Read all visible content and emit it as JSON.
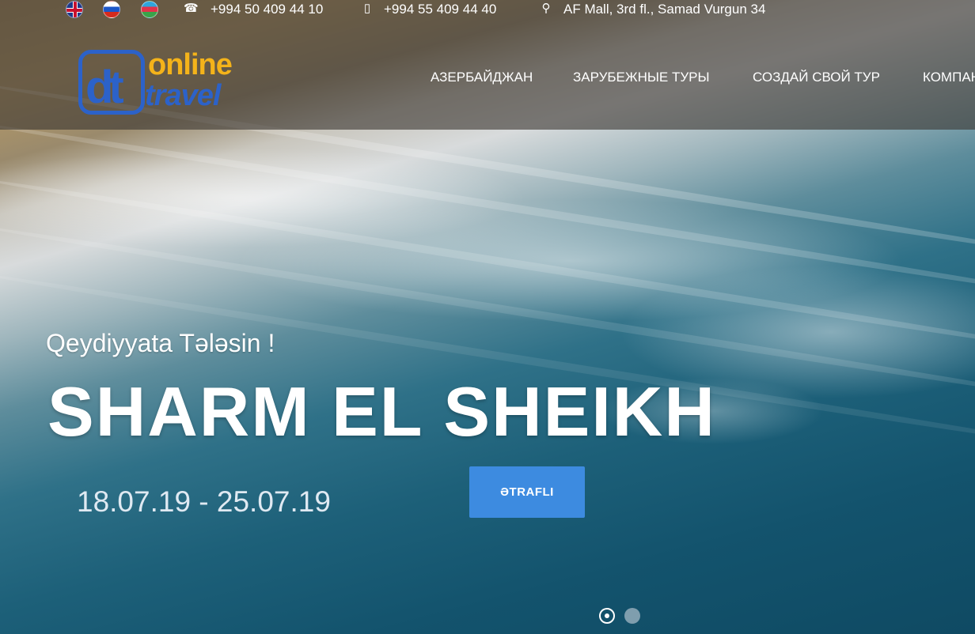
{
  "topbar": {
    "languages": [
      "English",
      "Русский",
      "Azərbaycan"
    ],
    "phone1": "+994 50 409 44 10",
    "phone2": "+994 55 409 44 40",
    "address": "AF Mall, 3rd fl., Samad Vurgun 34",
    "icons": {
      "phone": "phone-icon",
      "mobile": "mobile-icon",
      "location": "map-pin-icon"
    }
  },
  "logo": {
    "mark": "dt",
    "word1": "online",
    "word2": "travel"
  },
  "nav": {
    "items": [
      {
        "label": "АЗЕРБАЙДЖАН"
      },
      {
        "label": "ЗАРУБЕЖНЫЕ ТУРЫ"
      },
      {
        "label": "СОЗДАЙ СВОЙ ТУР"
      },
      {
        "label": "КОМПАНИЯ"
      }
    ]
  },
  "hero": {
    "subtitle": "Qeydiyyata Tələsin !",
    "title": "SHARM EL SHEIKH",
    "dates": "18.07.19 - 25.07.19",
    "cta_label": "ƏTRAFLI",
    "slides_total": 2,
    "active_slide": 1
  },
  "colors": {
    "brand_blue": "#2c62c9",
    "brand_yellow": "#f4b31a",
    "cta_blue": "#3d8be0"
  }
}
